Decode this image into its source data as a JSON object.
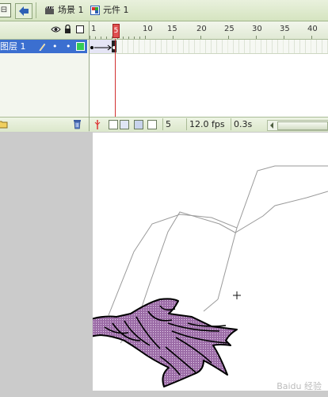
{
  "breadcrumbs": {
    "scene": "场景 1",
    "symbol": "元件 1"
  },
  "layers": [
    {
      "name": "图层 1",
      "eye": "•",
      "lock": "•",
      "color": "#33cc55"
    }
  ],
  "ruler": {
    "labels": [
      "1",
      "5",
      "10",
      "15",
      "20",
      "25",
      "30",
      "35",
      "40"
    ],
    "current_frame_marker": "5"
  },
  "status": {
    "current_frame": "5",
    "fps": "12.0 fps",
    "elapsed": "0.3s"
  },
  "watermark": {
    "text": "Baidu 经验",
    "url": "jingyan.baidu.com"
  },
  "colors": {
    "panel_green": "#d5e4c0",
    "selected_layer": "#3b6fd0",
    "playhead": "#e05050",
    "bird_fill": "#9b6ba6",
    "stage_outline": "#999999"
  }
}
